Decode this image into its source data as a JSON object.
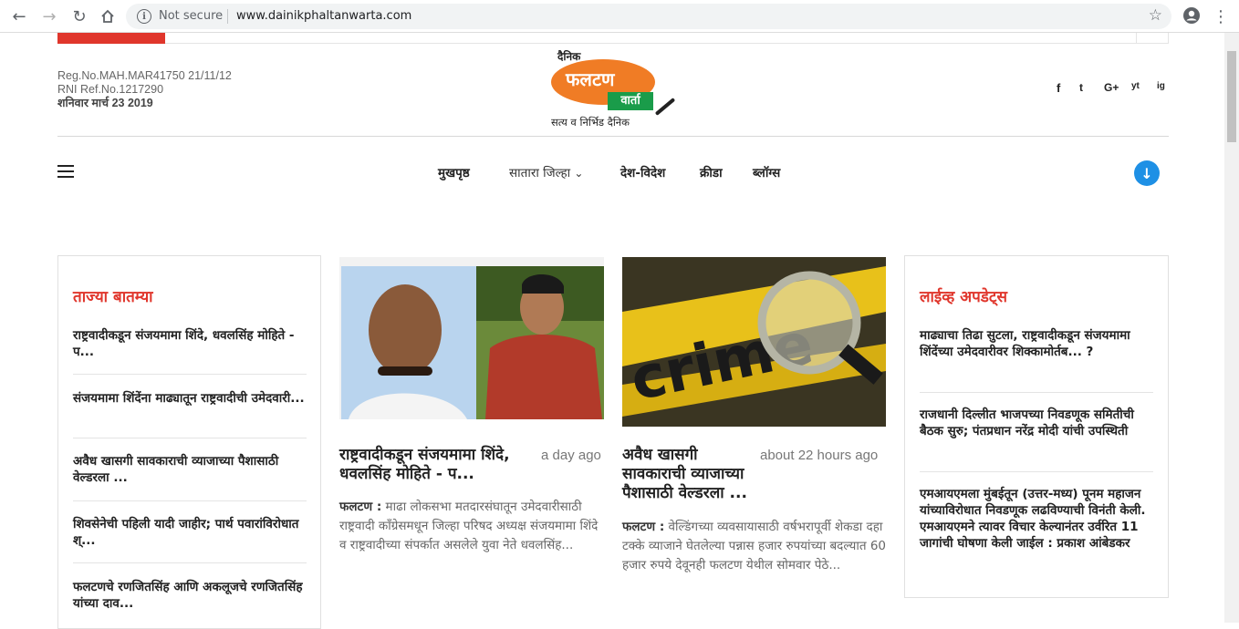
{
  "browser": {
    "security": "Not secure",
    "url": "www.dainikphaltanwarta.com"
  },
  "header": {
    "reg_no": "Reg.No.MAH.MAR41750 21/11/12",
    "rni": "RNI Ref.No.1217290",
    "date": "शनिवार मार्च 23 2019",
    "logo_top": "दैनिक",
    "logo_main": "फलटण",
    "logo_varta": "वार्ता",
    "logo_tag": "सत्य व निर्भिड दैनिक",
    "social": [
      "f",
      "t",
      "G+",
      "yt",
      "ig"
    ]
  },
  "nav": {
    "items": [
      "मुखपृष्ठ",
      "सातारा जिल्हा",
      "देश-विदेश",
      "क्रीडा",
      "ब्लॉग्स"
    ],
    "dropdown_glyph": "⌄",
    "download_glyph": "↓"
  },
  "latest": {
    "heading": "ताज्या बातम्या",
    "items": [
      "राष्ट्रवादीकडून संजयमामा शिंदे, धवलसिंह मोहिते - प...",
      "संजयमामा शिंदेंना माढ्यातून राष्ट्रवादीची उमेदवारी...",
      "अवैध खासगी सावकाराची व्याजाच्या पैशासाठी वेल्डरला ...",
      "शिवसेनेची पहिली यादी जाहीर; पार्थ पवारांविरोधात श्...",
      "फलटणचे रणजितसिंह आणि अकलूजचे रणजितसिंह यांच्या दाव..."
    ]
  },
  "articles": [
    {
      "title": "राष्ट्रवादीकडून संजयमामा शिंदे, धवलसिंह मोहिते - प...",
      "time": "a day ago",
      "place": "फलटण :",
      "summary": " माढा लोकसभा मतदारसंघातून उमेदवारीसाठी राष्ट्रवादी काँग्रेसमधून जिल्हा परिषद अध्यक्ष संजयमामा शिंदे व राष्ट्रवादीच्या संपर्कात असलेले युवा नेते धवलसिंह..."
    },
    {
      "title": "अवैध खासगी सावकाराची व्याजाच्या पैशासाठी वेल्डरला ...",
      "time": "about 22 hours ago",
      "place": "फलटण :",
      "summary": " वेल्डिंगच्या व्यवसायासाठी वर्षभरापूर्वी शेकडा दहा टक्के व्याजाने घेतलेल्या पन्नास हजार रुपयांच्या बदल्यात 60 हजार रुपये देवूनही फलटण येथील सोमवार पेठे...",
      "image_text": "crime"
    }
  ],
  "live": {
    "heading": "लाईव्ह अपडेट्स",
    "items": [
      "माढ्याचा तिढा सुटला, राष्ट्रवादीकडून संजयमामा शिंदेंच्या उमेदवारीवर शिक्कामोर्तब... ?",
      "राजधानी दिल्लीत भाजपच्या निवडणूक समितीची बैठक सुरु; पंतप्रधान नरेंद्र मोदी यांची उपस्थिती",
      "एमआयएमला मुंबईतून (उत्तर-मध्य) पूनम महाजन यांच्याविरोधात निवडणूक लढविण्याची विनंती केली. एमआयएमने त्यावर विचार केल्यानंतर उर्वरित 11 जागांची घोषणा केली जाईल : प्रकाश आंबेडकर"
    ]
  },
  "colors": {
    "accent_red": "#e0362c",
    "logo_orange": "#f07c25",
    "logo_green": "#1a9c4a",
    "download_blue": "#1e90e5"
  }
}
